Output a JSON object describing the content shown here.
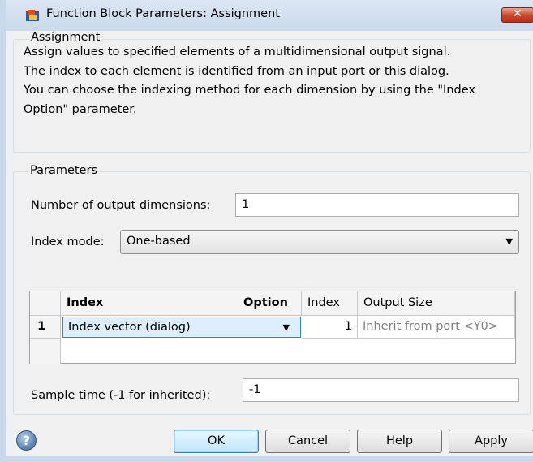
{
  "window": {
    "title": "Function Block Parameters: Assignment",
    "close_label": "✕"
  },
  "block": {
    "group_title": "Assignment",
    "description_lines": [
      "Assign values to specified elements of a multidimensional output signal.",
      "The index to each element is identified from an input port or this dialog.",
      "You can choose the indexing method for each dimension by using the \"Index",
      "Option\" parameter."
    ]
  },
  "parameters": {
    "group_title": "Parameters",
    "num_dims_label": "Number of output dimensions:",
    "num_dims_value": "1",
    "index_mode_label": "Index mode:",
    "index_mode_value": "One-based",
    "table": {
      "headers": {
        "index": "Index",
        "option": "Option",
        "index_value": "Index",
        "output_size": "Output Size"
      },
      "rows": [
        {
          "row": "1",
          "index_option": "Index vector (dialog)",
          "index_value": "1",
          "output_size": "Inherit from port <Y0>"
        }
      ]
    },
    "sample_time_label": "Sample time (-1 for inherited):",
    "sample_time_value": "-1"
  },
  "buttons": {
    "ok": "OK",
    "cancel": "Cancel",
    "help": "Help",
    "apply": "Apply",
    "help_icon": "?"
  },
  "icons": {
    "app": "simulink-block-icon",
    "help": "question-mark-icon",
    "dropdown": "chevron-down-icon"
  },
  "colors": {
    "close_button": "#c9452d",
    "selected_combo": "#ddeeff",
    "disabled_text": "#808080"
  }
}
